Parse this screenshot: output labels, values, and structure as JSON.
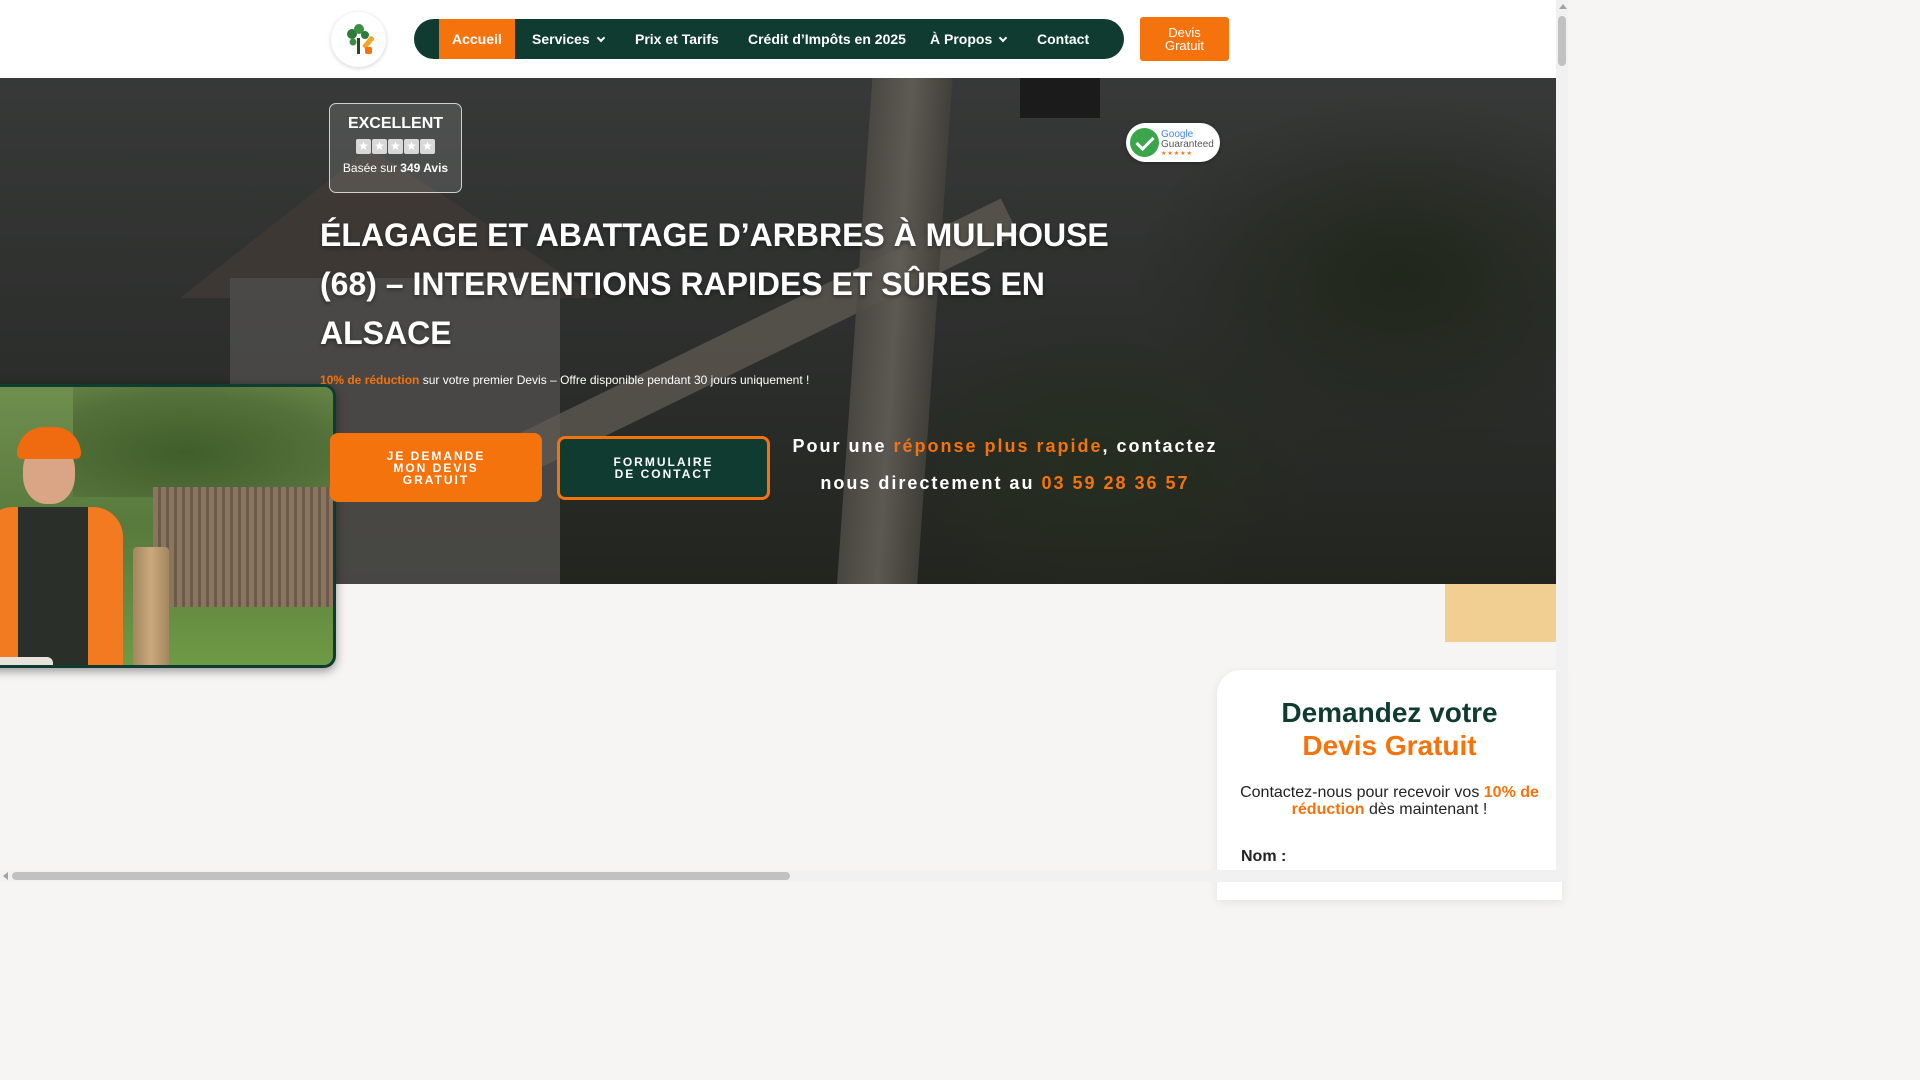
{
  "header": {
    "logo_icon": "tree-chainsaw-logo-icon",
    "nav": [
      {
        "label": "Accueil",
        "active": true,
        "dropdown": false
      },
      {
        "label": "Services",
        "active": false,
        "dropdown": true
      },
      {
        "label": "Prix et Tarifs",
        "active": false,
        "dropdown": false
      },
      {
        "label": "Crédit d’Impôts en 2025",
        "active": false,
        "dropdown": false
      },
      {
        "label": "À Propos",
        "active": false,
        "dropdown": true
      },
      {
        "label": "Contact",
        "active": false,
        "dropdown": false
      }
    ],
    "cta_line1": "Devis",
    "cta_line2": "Gratuit"
  },
  "hero": {
    "rating": {
      "title": "EXCELLENT",
      "stars": 5,
      "sub_prefix": "Basée sur",
      "sub_count": "349 Avis"
    },
    "badge": {
      "line1": "Google",
      "line2": "Guaranteed",
      "stars": "★★★★★"
    },
    "title": "ÉLAGAGE ET ABATTAGE D’ARBRES À MULHOUSE (68) – INTERVENTIONS RAPIDES ET SÛRES EN ALSACE",
    "promo_highlight": "10% de réduction",
    "promo_rest": " sur votre premier Devis – Offre disponible pendant 30 jours uniquement !",
    "btn_devis_l1": "JE DEMANDE",
    "btn_devis_l2": "MON DEVIS",
    "btn_devis_l3": "GRATUIT",
    "btn_form_l1": "FORMULAIRE",
    "btn_form_l2": "DE CONTACT",
    "callout_a": "Pour une ",
    "callout_b": "réponse plus rapide",
    "callout_c": ", contactez nous directement au ",
    "callout_phone": "03 59 28 36 57"
  },
  "form": {
    "title_line1": "Demandez votre",
    "title_line2": "Devis Gratuit",
    "sub_a": "Contactez-nous pour recevoir vos ",
    "sub_b": "10% de réduction",
    "sub_c": " dès maintenant !",
    "name_label": "Nom :"
  },
  "colors": {
    "accent": "#f5730d",
    "brand_dark": "#0f3b30",
    "beige": "#f1cf93"
  }
}
